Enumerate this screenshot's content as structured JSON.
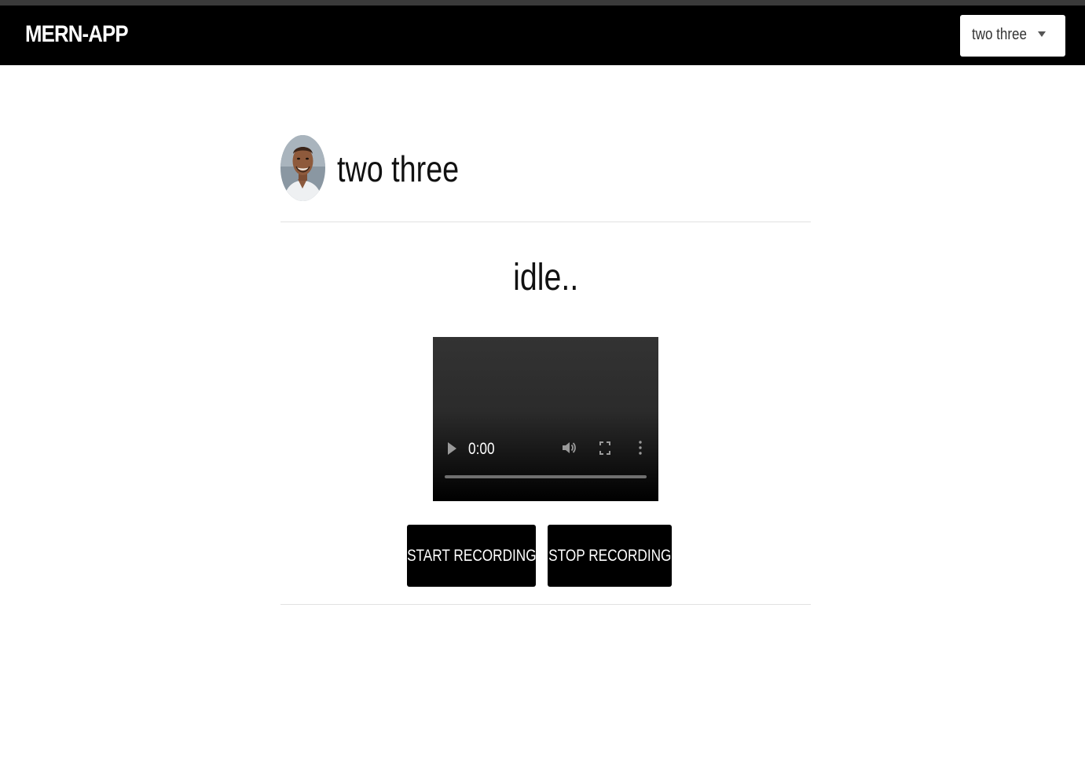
{
  "navbar": {
    "brand": "MERN-APP",
    "user_menu_label": "two three",
    "user_menu_icon": "chevron-down-icon"
  },
  "profile": {
    "name": "two three",
    "avatar_icon": "avatar"
  },
  "recorder": {
    "status": "idle..",
    "player": {
      "time": "0:00",
      "progress": 0,
      "icons": [
        "play-icon",
        "volume-icon",
        "fullscreen-icon",
        "more-icon"
      ]
    },
    "start_label": "START RECORDING",
    "stop_label": "STOP RECORDING"
  },
  "colors": {
    "navbar_bg": "#000000",
    "button_bg": "#000000",
    "button_text": "#ffffff",
    "divider": "#e2e2e2"
  }
}
